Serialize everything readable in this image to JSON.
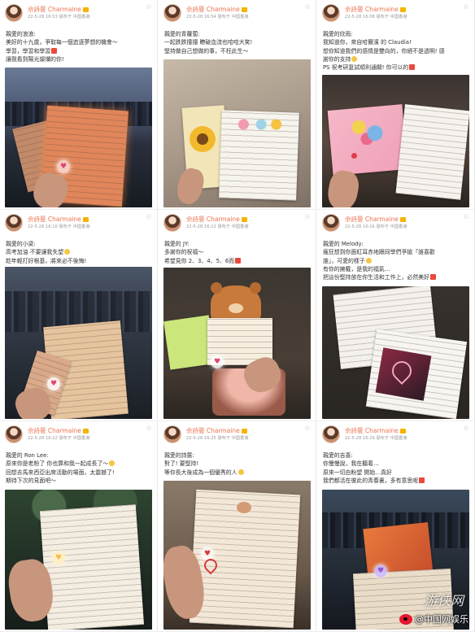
{
  "posts": [
    {
      "name": "佘詩曼 Charmaine",
      "meta": "22-5-28 16:53 發布于 中国香港",
      "lines": [
        "親愛的浪浪:",
        "美好的十九歲，爭取每一個追逐夢想的機會～",
        "學習，學習和學習",
        "讓我看到陽光燦爛的你!"
      ]
    },
    {
      "name": "佘詩曼 Charmaine",
      "meta": "22-5-28 16:54 發布于 中国香港",
      "lines": [
        "親愛的青蘿蔔:",
        "一起跌跌撞撞 瞭破血流也哈哈大笑!",
        "堅持做自己想做的事，不枉此生～"
      ]
    },
    {
      "name": "佘詩曼 Charmaine",
      "meta": "22-5-28 16:08 發布于 中国香港",
      "lines": [
        "親愛的欣雨:",
        "我知道你，來自哈爾濱 的 Claudia!",
        "想你知道我們的感情是雙向的，你絕不是透明! 感",
        "謝你的支持",
        "PS 祝考研复試順利通關! 你可以的"
      ]
    },
    {
      "name": "佘詩曼 Charmaine",
      "meta": "22-5-28 16:10 發布于 中国香港",
      "lines": [
        "親愛的小梁:",
        "高考加油 不要讓我失望",
        "趁年輕打好根基，將來必不後悔!"
      ]
    },
    {
      "name": "佘詩曼 Charmaine",
      "meta": "22-5-28 16:12 發布于 中国香港",
      "lines": [
        "親愛的 JY:",
        "多謝你的祝福～",
        "希望見你 2、3、4、5、6而"
      ]
    },
    {
      "name": "佘詩曼 Charmaine",
      "meta": "22-5-28 16:16 發布于 中国香港",
      "lines": [
        "親愛的 Melody:",
        "瘋狂想到你面紅耳赤地跟同學們爭搶「誰喜歡",
        "誰」，可愛的樣子",
        "有你的擁戴，是我的福氣…",
        "把這份堅持放在你生活和工作上，必然美好"
      ]
    },
    {
      "name": "佘詩曼 Charmaine",
      "meta": "22-5-28 16:22 發布于 中国香港",
      "lines": [
        "親愛的 Ron Lee:",
        "原來你是老粉了 你也算和我一起成長了～",
        "回想去馬來西亞出席活動的場面，太震撼了!",
        "期待下次的見面吧～"
      ]
    },
    {
      "name": "佘詩曼 Charmaine",
      "meta": "22-5-28 16:25 發布于 中国香港",
      "lines": [
        "親愛的詩蕙:",
        "對了! 要堅持!",
        "等你長大後成為一個優秀的人"
      ]
    },
    {
      "name": "佘詩曼 Charmaine",
      "meta": "22-5-28 16:29 發布于 中国香港",
      "lines": [
        "親愛的吉喜:",
        "你慢慢說，我在聽着…",
        "原來一切由盼望 開始…真好",
        "我們都活在彼此的青春裏，多有意思呢"
      ]
    }
  ],
  "watermark": {
    "brand": "@中国网娱乐",
    "overlay": "游侠网"
  },
  "colors": {
    "name": "#eb7350",
    "meta": "#999999",
    "text": "#333333"
  }
}
